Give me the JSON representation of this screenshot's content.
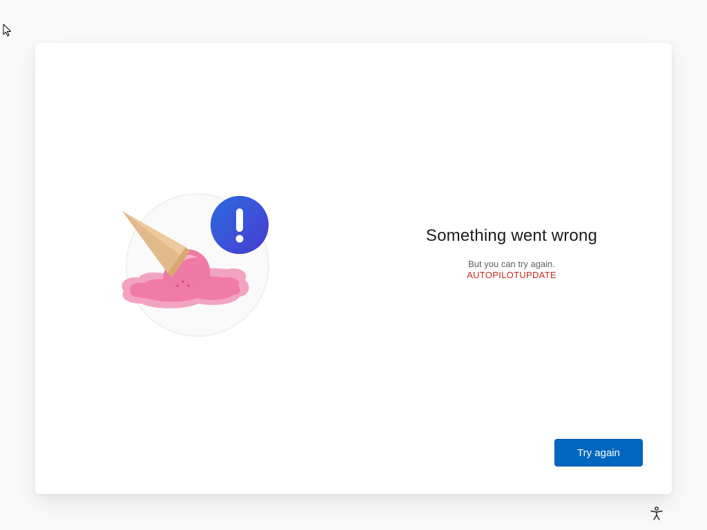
{
  "screen": {
    "title": "Something went wrong",
    "subtitle": "But you can try again.",
    "error_code": "AUTOPILOTUPDATE"
  },
  "actions": {
    "try_again_label": "Try again"
  },
  "icons": {
    "illustration": "melted-ice-cream-error-illustration",
    "badge": "exclamation-icon",
    "cursor": "mouse-cursor-icon",
    "accessibility": "accessibility-icon"
  },
  "colors": {
    "accent": "#0067c0",
    "error_text": "#c42b1c",
    "badge": "#3a4fd6",
    "ice_cream": "#f07ba6",
    "cone": "#e2b98a"
  }
}
